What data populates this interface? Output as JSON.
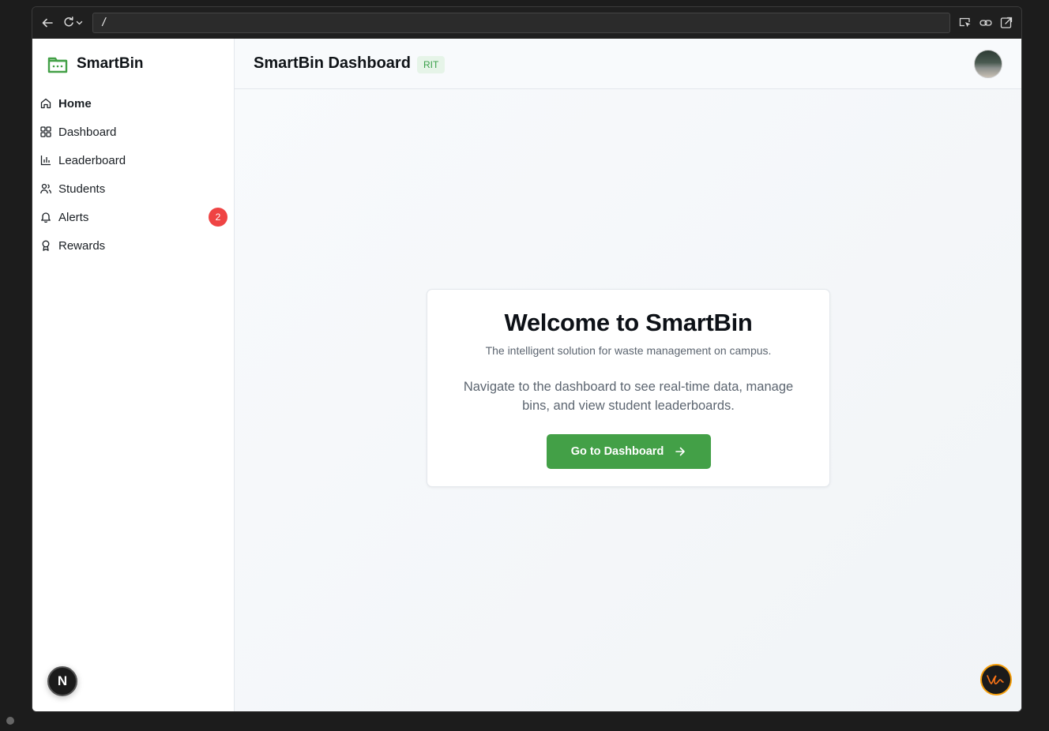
{
  "browser": {
    "url": "/"
  },
  "sidebar": {
    "brand": "SmartBin",
    "items": [
      {
        "label": "Home",
        "icon": "home-icon",
        "active": true
      },
      {
        "label": "Dashboard",
        "icon": "grid-icon"
      },
      {
        "label": "Leaderboard",
        "icon": "bar-chart-icon"
      },
      {
        "label": "Students",
        "icon": "users-icon"
      },
      {
        "label": "Alerts",
        "icon": "bell-icon",
        "badge": "2"
      },
      {
        "label": "Rewards",
        "icon": "award-icon"
      }
    ],
    "next_label": "N"
  },
  "header": {
    "title": "SmartBin Dashboard",
    "badge": "RIT"
  },
  "welcome": {
    "title": "Welcome to SmartBin",
    "subtitle": "The intelligent solution for waste management on campus.",
    "description": "Navigate to the dashboard to see real-time data, manage bins, and view student leaderboards.",
    "cta": "Go to Dashboard"
  },
  "colors": {
    "brand_green": "#43a047",
    "badge_red": "#ef4444"
  }
}
